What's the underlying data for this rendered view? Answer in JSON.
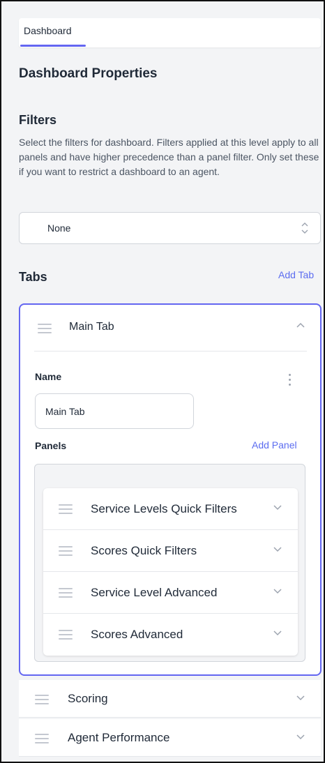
{
  "tabs": {
    "active_label": "Dashboard"
  },
  "properties": {
    "title": "Dashboard Properties",
    "filters_heading": "Filters",
    "filters_description": "Select the filters for dashboard. Filters applied at this level apply to all panels and have higher precedence than a panel filter. Only set these if you want to restrict a dashboard to an agent.",
    "filter_select_value": "None"
  },
  "tabs_section": {
    "heading": "Tabs",
    "add_tab_label": "Add Tab",
    "expanded_tab": {
      "title": "Main Tab",
      "name_label": "Name",
      "name_value": "Main Tab",
      "panels_label": "Panels",
      "add_panel_label": "Add Panel",
      "panels": [
        {
          "label": "Service Levels Quick Filters"
        },
        {
          "label": "Scores Quick Filters"
        },
        {
          "label": "Service Level Advanced"
        },
        {
          "label": "Scores Advanced"
        }
      ]
    },
    "collapsed_tabs": [
      {
        "label": "Scoring"
      },
      {
        "label": "Agent Performance"
      }
    ]
  },
  "colors": {
    "accent": "#6366f1",
    "link": "#5b6cf0",
    "background": "#f3f4f6"
  },
  "icons": {
    "drag_handle": "drag-handle-icon",
    "chevron_up": "chevron-up-icon",
    "chevron_down": "chevron-down-icon",
    "select_arrows": "up-down-chevron-icon",
    "kebab": "kebab-menu-icon"
  }
}
